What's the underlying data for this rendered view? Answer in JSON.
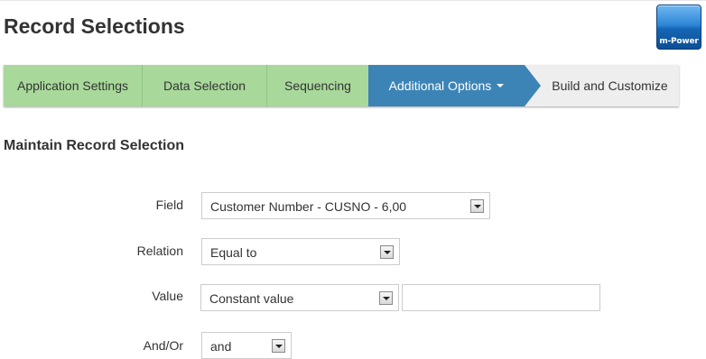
{
  "page": {
    "title": "Record Selections"
  },
  "logo": {
    "text": "m-Power"
  },
  "wizard": {
    "steps": [
      {
        "label": "Application Settings",
        "state": "done"
      },
      {
        "label": "Data Selection",
        "state": "done"
      },
      {
        "label": "Sequencing",
        "state": "done"
      },
      {
        "label": "Additional Options",
        "state": "active"
      },
      {
        "label": "Build and Customize",
        "state": "todo"
      }
    ]
  },
  "section": {
    "title": "Maintain Record Selection"
  },
  "form": {
    "field": {
      "label": "Field",
      "value": "Customer Number - CUSNO - 6,00"
    },
    "relation": {
      "label": "Relation",
      "value": "Equal to"
    },
    "value": {
      "label": "Value",
      "type_value": "Constant value",
      "input_value": ""
    },
    "andor": {
      "label": "And/Or",
      "value": "and"
    }
  },
  "colors": {
    "done": "#a8d99a",
    "active": "#3c84b6",
    "todo": "#eeeeee"
  }
}
